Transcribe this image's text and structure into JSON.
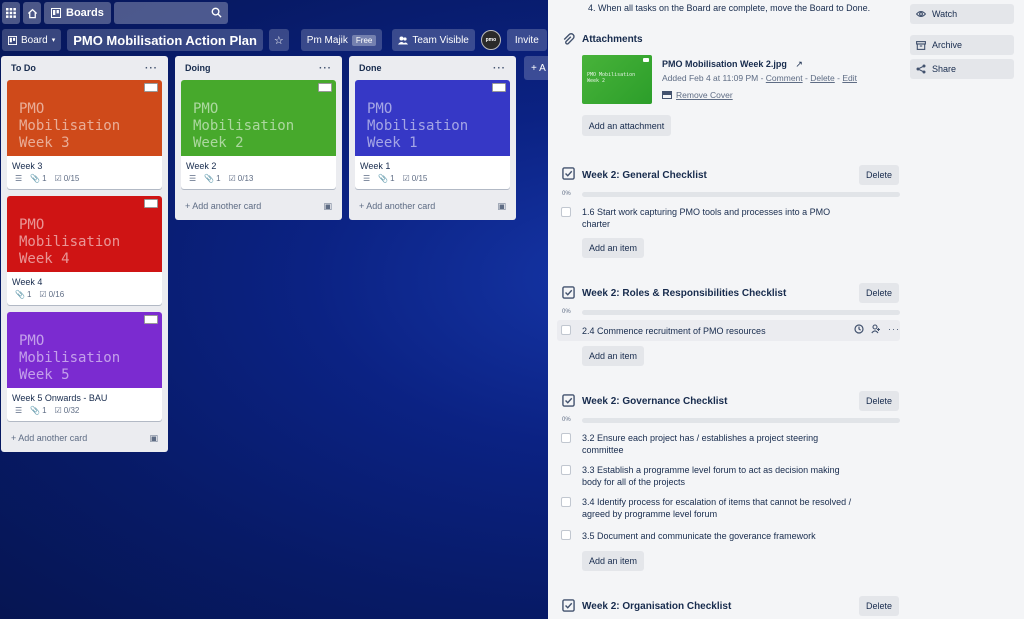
{
  "colors": {
    "board_bg": "#0b2283",
    "week1_cover": "#3638c6",
    "week2_cover": "#47a92c",
    "week3_cover": "#cf4a1a",
    "week4_cover": "#cf1414",
    "week5_cover": "#7b2bd0",
    "panel_bg": "#f4f5f7",
    "progress_fill": "#5ba4cf"
  },
  "nav": {
    "apps_icon": "grid-icon",
    "home_icon": "house-icon",
    "boards_label": "Boards",
    "search_icon": "magnifier-icon"
  },
  "header": {
    "board_switch_label": "Board",
    "board_title": "PMO Mobilisation Action Plan",
    "team_label": "Pm Majik",
    "team_plan": "Free",
    "visibility_label": "Team Visible",
    "avatar_text": "pmo",
    "invite_label": "Invite"
  },
  "lists": [
    {
      "name": "To Do",
      "menu": "···",
      "cards": [
        {
          "cover_line1": "PMO Mobilisation",
          "cover_line2": "Week 3",
          "title": "Week 3",
          "attachments": "1",
          "checklist": "0/15"
        },
        {
          "cover_line1": "PMO Mobilisation",
          "cover_line2": "Week 4",
          "title": "Week 4",
          "attachments": "1",
          "checklist": "0/16"
        },
        {
          "cover_line1": "PMO Mobilisation",
          "cover_line2": "Week 5",
          "title": "Week 5 Onwards - BAU",
          "attachments": "1",
          "checklist": "0/32"
        }
      ],
      "add_card": "Add another card"
    },
    {
      "name": "Doing",
      "menu": "···",
      "cards": [
        {
          "cover_line1": "PMO Mobilisation",
          "cover_line2": "Week 2",
          "title": "Week 2",
          "attachments": "1",
          "checklist": "0/13"
        }
      ],
      "add_card": "Add another card"
    },
    {
      "name": "Done",
      "menu": "···",
      "cards": [
        {
          "cover_line1": "PMO Mobilisation",
          "cover_line2": "Week 1",
          "title": "Week 1",
          "attachments": "1",
          "checklist": "0/15"
        }
      ],
      "add_card": "Add another card"
    }
  ],
  "add_list_label": "+ A",
  "detail": {
    "description_tail": "4. When all tasks on the Board are complete, move the Board to Done.",
    "attachments": {
      "title": "Attachments",
      "thumb_line1": "PMO Mobilisation",
      "thumb_line2": "Week 2",
      "file_name": "PMO Mobilisation Week 2.jpg",
      "open_icon": "↗",
      "added": "Added Feb 4 at 11:09 PM - ",
      "comment": "Comment",
      "sep": " - ",
      "delete": "Delete",
      "edit": "Edit",
      "remove_cover": "Remove Cover",
      "add_attachment": "Add an attachment"
    },
    "checklists": [
      {
        "title": "Week 2: General Checklist",
        "delete": "Delete",
        "percent": "0%",
        "progress": 0,
        "items": [
          "1.6 Start work capturing PMO tools and processes into a PMO charter"
        ],
        "add_item": "Add an item"
      },
      {
        "title": "Week 2: Roles & Responsibilities Checklist",
        "delete": "Delete",
        "percent": "0%",
        "progress": 0,
        "items": [
          "2.4 Commence recruitment of PMO resources"
        ],
        "add_item": "Add an item"
      },
      {
        "title": "Week 2: Governance Checklist",
        "delete": "Delete",
        "percent": "0%",
        "progress": 0,
        "items": [
          "3.2 Ensure each project has / establishes a project steering committee",
          "3.3 Establish a programme level forum to act as decision making body for all of the projects",
          "3.4 Identify process for escalation of items that cannot be resolved / agreed by programme level forum",
          "3.5 Document and communicate the goverance framework"
        ],
        "add_item": "Add an item"
      },
      {
        "title": "Week 2: Organisation Checklist",
        "delete": "Delete"
      }
    ],
    "sidebar": {
      "watch": "Watch",
      "archive": "Archive",
      "share": "Share"
    }
  }
}
